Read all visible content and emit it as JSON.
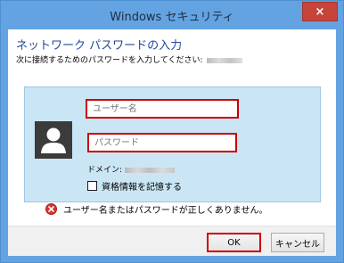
{
  "window": {
    "title": "Windows セキュリティ",
    "close_label": "×"
  },
  "dialog": {
    "heading": "ネットワーク パスワードの入力",
    "subtext": "次に接続するためのパスワードを入力してください:"
  },
  "form": {
    "username_placeholder": "ユーザー名",
    "password_placeholder": "パスワード",
    "domain_label": "ドメイン:",
    "remember_label": "資格情報を記憶する"
  },
  "error": {
    "message": "ユーザー名またはパスワードが正しくありません。"
  },
  "buttons": {
    "ok": "OK",
    "cancel": "キャンセル"
  },
  "colors": {
    "title_bar": "#64a3e2",
    "close_button": "#c7443a",
    "heading_text": "#1f4a9a",
    "panel_bg": "#cae6f5",
    "highlight": "#cc0000"
  },
  "icons": {
    "close": "close-icon",
    "avatar": "user-avatar-icon",
    "error": "error-icon",
    "checkbox": "checkbox-icon"
  }
}
